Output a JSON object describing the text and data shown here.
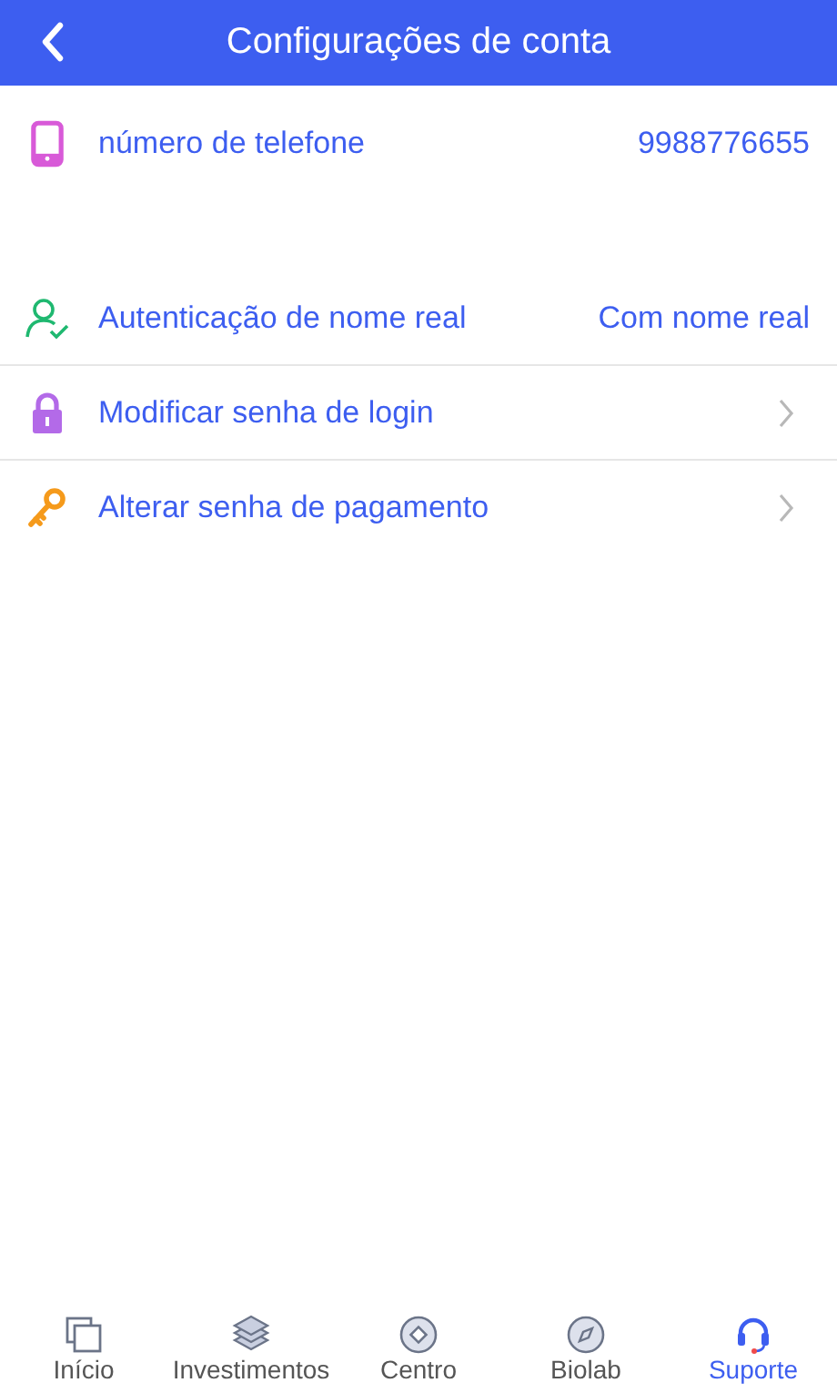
{
  "header": {
    "title": "Configurações de conta"
  },
  "rows": [
    {
      "kind": "phone",
      "label": "número de telefone",
      "value": "9988776655",
      "chevron": false,
      "divider": false
    },
    {
      "kind": "person",
      "label": "Autenticação de nome real",
      "value": "Com nome real",
      "chevron": false,
      "divider": true
    },
    {
      "kind": "lock",
      "label": "Modificar senha de login",
      "chevron": true,
      "divider": true
    },
    {
      "kind": "key",
      "label": "Alterar senha de pagamento",
      "chevron": true,
      "divider": false
    }
  ],
  "tabs": [
    {
      "kind": "home",
      "label": "Início",
      "selected": false
    },
    {
      "kind": "layers",
      "label": "Investimentos",
      "selected": false
    },
    {
      "kind": "center",
      "label": "Centro",
      "selected": false
    },
    {
      "kind": "compass",
      "label": "Biolab",
      "selected": false
    },
    {
      "kind": "support",
      "label": "Suporte",
      "selected": true
    }
  ]
}
